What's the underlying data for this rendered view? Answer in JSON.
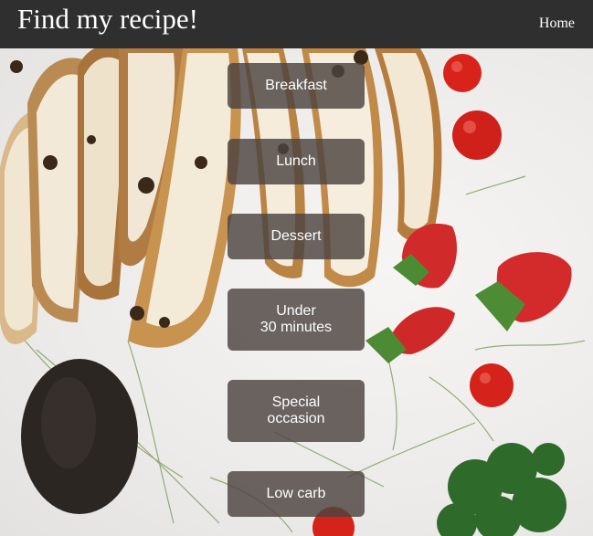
{
  "header": {
    "title": "Find my recipe!",
    "home_label": "Home"
  },
  "menu": {
    "items": [
      {
        "label": "Breakfast"
      },
      {
        "label": "Lunch"
      },
      {
        "label": "Dessert"
      },
      {
        "label": "Under\n30 minutes"
      },
      {
        "label": "Special\noccasion"
      },
      {
        "label": "Low carb"
      }
    ]
  },
  "colors": {
    "header_bg": "#2f2f2f",
    "button_bg": "rgba(76,67,64,0.82)",
    "text": "#ffffff"
  }
}
